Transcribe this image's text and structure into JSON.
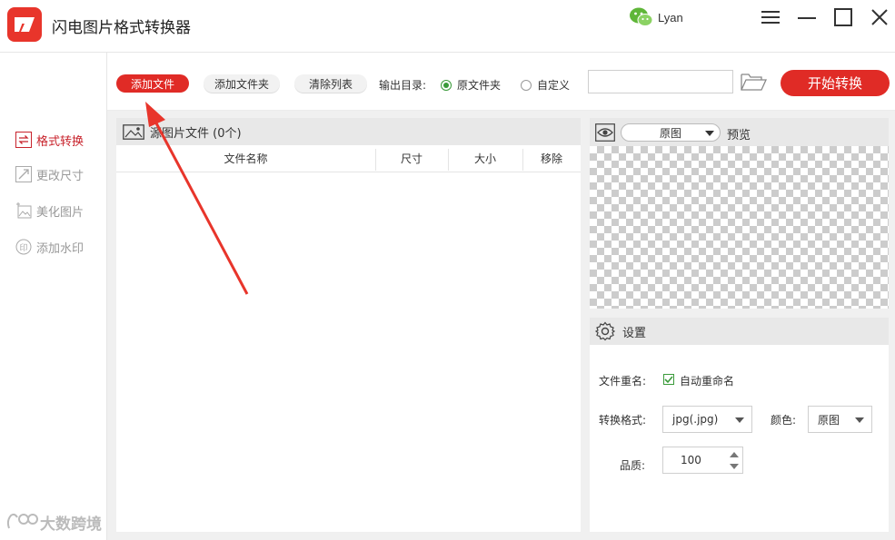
{
  "app": {
    "title": "闪电图片格式转换器",
    "user_name": "Lyan"
  },
  "sidebar": {
    "items": [
      {
        "label": "格式转换",
        "icon": "swap-arrows-icon",
        "active": true
      },
      {
        "label": "更改尺寸",
        "icon": "resize-icon",
        "active": false
      },
      {
        "label": "美化图片",
        "icon": "beautify-image-icon",
        "active": false
      },
      {
        "label": "添加水印",
        "icon": "stamp-icon",
        "active": false
      }
    ]
  },
  "toolbar": {
    "add_file": "添加文件",
    "add_folder": "添加文件夹",
    "clear_list": "清除列表",
    "output_label": "输出目录:",
    "output_options": [
      "原文件夹",
      "自定义"
    ],
    "output_selected": "原文件夹",
    "path_value": "",
    "start_button": "开始转换"
  },
  "file_panel": {
    "title": "源图片文件 (0个)",
    "columns": [
      "文件名称",
      "尺寸",
      "大小",
      "移除"
    ],
    "rows": []
  },
  "preview": {
    "mode": "原图",
    "label": "预览"
  },
  "settings": {
    "title": "设置",
    "rename_label": "文件重名:",
    "auto_rename_label": "自动重命名",
    "auto_rename_checked": true,
    "format_label": "转换格式:",
    "format_value": "jpg(.jpg)",
    "color_label": "颜色:",
    "color_value": "原图",
    "quality_label": "品质:",
    "quality_value": "100"
  },
  "watermark": {
    "text": "大数跨境"
  },
  "colors": {
    "accent": "#e02b26",
    "active_nav": "#c8232c",
    "radio_green": "#3a9a3a"
  }
}
